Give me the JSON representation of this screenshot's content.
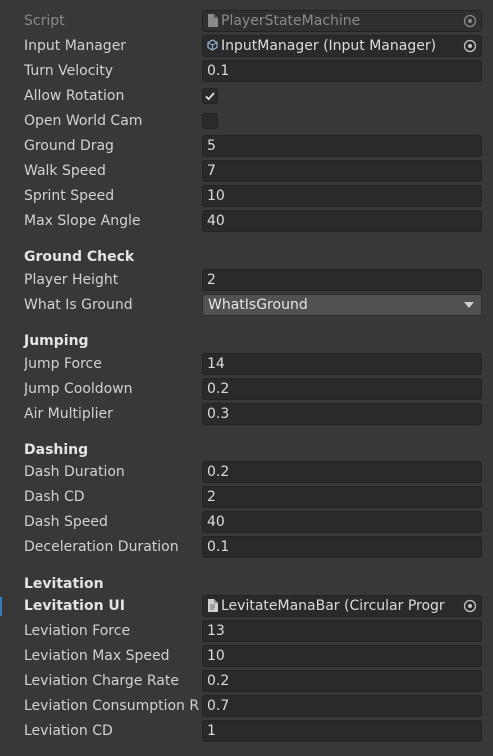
{
  "script": {
    "label": "Script",
    "value": "PlayerStateMachine"
  },
  "general": {
    "input_manager": {
      "label": "Input Manager",
      "value": "InputManager (Input Manager)"
    },
    "turn_velocity": {
      "label": "Turn Velocity",
      "value": "0.1"
    },
    "allow_rotation": {
      "label": "Allow Rotation",
      "checked": true
    },
    "open_world_cam": {
      "label": "Open World Cam",
      "checked": false
    },
    "ground_drag": {
      "label": "Ground Drag",
      "value": "5"
    },
    "walk_speed": {
      "label": "Walk Speed",
      "value": "7"
    },
    "sprint_speed": {
      "label": "Sprint Speed",
      "value": "10"
    },
    "max_slope_angle": {
      "label": "Max Slope Angle",
      "value": "40"
    }
  },
  "ground_check": {
    "header": "Ground Check",
    "player_height": {
      "label": "Player Height",
      "value": "2"
    },
    "what_is_ground": {
      "label": "What Is Ground",
      "value": "WhatIsGround"
    }
  },
  "jumping": {
    "header": "Jumping",
    "jump_force": {
      "label": "Jump Force",
      "value": "14"
    },
    "jump_cooldown": {
      "label": "Jump Cooldown",
      "value": "0.2"
    },
    "air_multiplier": {
      "label": "Air Multiplier",
      "value": "0.3"
    }
  },
  "dashing": {
    "header": "Dashing",
    "dash_duration": {
      "label": "Dash Duration",
      "value": "0.2"
    },
    "dash_cd": {
      "label": "Dash CD",
      "value": "2"
    },
    "dash_speed": {
      "label": "Dash Speed",
      "value": "40"
    },
    "deceleration_duration": {
      "label": "Deceleration Duration",
      "value": "0.1"
    }
  },
  "levitation": {
    "header": "Levitation",
    "levitation_ui": {
      "label": "Levitation UI",
      "value": "LevitateManaBar (Circular Progr"
    },
    "leviation_force": {
      "label": "Leviation Force",
      "value": "13"
    },
    "leviation_max_speed": {
      "label": "Leviation Max Speed",
      "value": "10"
    },
    "leviation_charge_rate": {
      "label": "Leviation Charge Rate",
      "value": "0.2"
    },
    "leviation_consumption_rate": {
      "label": "Leviation Consumption R",
      "value": "0.7"
    },
    "leviation_cd": {
      "label": "Leviation CD",
      "value": "1"
    }
  },
  "icons": {
    "script_file": "script-file-icon",
    "object_picker": "object-picker-icon",
    "input_manager_obj": "input-manager-object-icon",
    "checkmark": "checkmark-icon",
    "dropdown_arrow": "dropdown-arrow-icon"
  },
  "colors": {
    "background": "#383838",
    "field": "#2a2a2a",
    "selection_accent": "#3a79bb"
  }
}
